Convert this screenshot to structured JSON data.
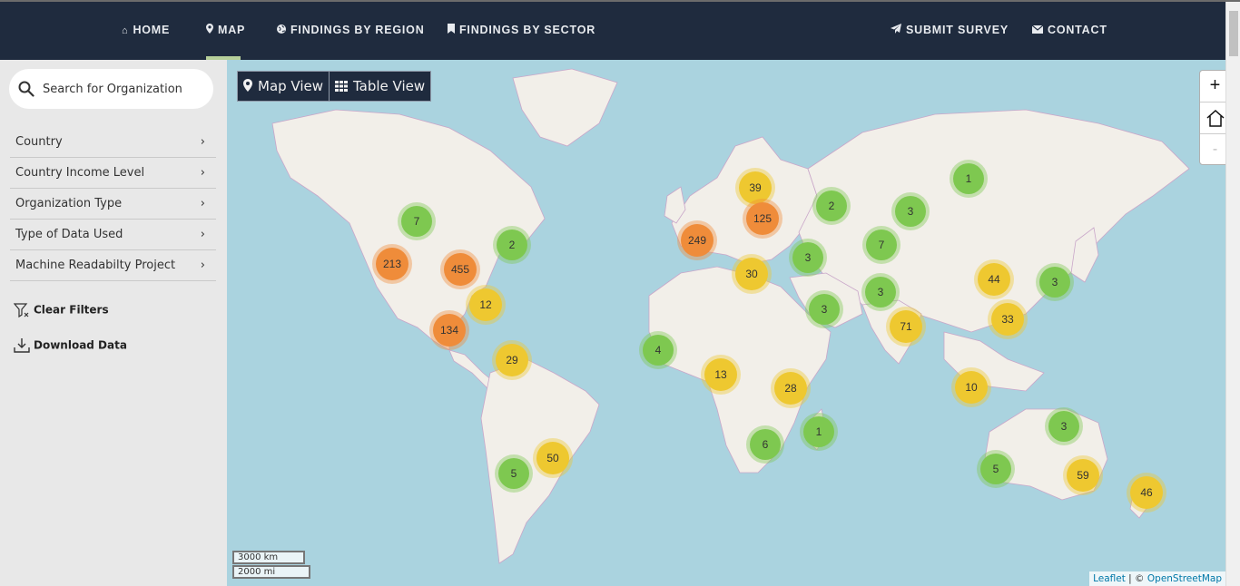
{
  "nav": {
    "items": [
      {
        "label": "HOME",
        "icon": "home-icon"
      },
      {
        "label": "MAP",
        "icon": "map-marker-icon",
        "active": true
      },
      {
        "label": "FINDINGS BY REGION",
        "icon": "globe-icon"
      },
      {
        "label": "FINDINGS BY SECTOR",
        "icon": "bookmark-icon"
      },
      {
        "label": "SUBMIT SURVEY",
        "icon": "paper-plane-icon"
      },
      {
        "label": "CONTACT",
        "icon": "envelope-icon"
      }
    ]
  },
  "sidebar": {
    "search_placeholder": "Search for Organization",
    "filters": [
      {
        "label": "Country"
      },
      {
        "label": "Country Income Level"
      },
      {
        "label": "Organization Type"
      },
      {
        "label": "Type of Data Used"
      },
      {
        "label": "Machine Readabilty Project"
      }
    ],
    "clear_filters": "Clear Filters",
    "download_data": "Download Data"
  },
  "map": {
    "map_view_label": "Map View",
    "table_view_label": "Table View",
    "zoom_in": "+",
    "zoom_out": "-",
    "scale_km": "3000 km",
    "scale_mi": "2000 mi",
    "attribution_leaflet": "Leaflet",
    "attribution_sep": " | © ",
    "attribution_osm": "OpenStreetMap",
    "colors": {
      "small": "#7ec850",
      "medium": "#eec830",
      "large": "#ef8c3a",
      "water": "#aad3df",
      "land": "#f2efe9"
    },
    "clusters": [
      {
        "count": "7",
        "size": "small"
      },
      {
        "count": "2",
        "size": "small"
      },
      {
        "count": "213",
        "size": "large"
      },
      {
        "count": "455",
        "size": "large"
      },
      {
        "count": "12",
        "size": "medium"
      },
      {
        "count": "134",
        "size": "large"
      },
      {
        "count": "29",
        "size": "medium"
      },
      {
        "count": "50",
        "size": "medium"
      },
      {
        "count": "5",
        "size": "small"
      },
      {
        "count": "39",
        "size": "medium"
      },
      {
        "count": "125",
        "size": "large"
      },
      {
        "count": "249",
        "size": "large"
      },
      {
        "count": "30",
        "size": "medium"
      },
      {
        "count": "2",
        "size": "small"
      },
      {
        "count": "3",
        "size": "small"
      },
      {
        "count": "1",
        "size": "small"
      },
      {
        "count": "7",
        "size": "small"
      },
      {
        "count": "3",
        "size": "small"
      },
      {
        "count": "3",
        "size": "small"
      },
      {
        "count": "3",
        "size": "small"
      },
      {
        "count": "44",
        "size": "medium"
      },
      {
        "count": "3",
        "size": "small"
      },
      {
        "count": "71",
        "size": "medium"
      },
      {
        "count": "33",
        "size": "medium"
      },
      {
        "count": "4",
        "size": "small"
      },
      {
        "count": "13",
        "size": "medium"
      },
      {
        "count": "28",
        "size": "medium"
      },
      {
        "count": "1",
        "size": "small"
      },
      {
        "count": "6",
        "size": "small"
      },
      {
        "count": "10",
        "size": "medium"
      },
      {
        "count": "3",
        "size": "small"
      },
      {
        "count": "5",
        "size": "small"
      },
      {
        "count": "59",
        "size": "medium"
      },
      {
        "count": "46",
        "size": "medium"
      }
    ]
  }
}
